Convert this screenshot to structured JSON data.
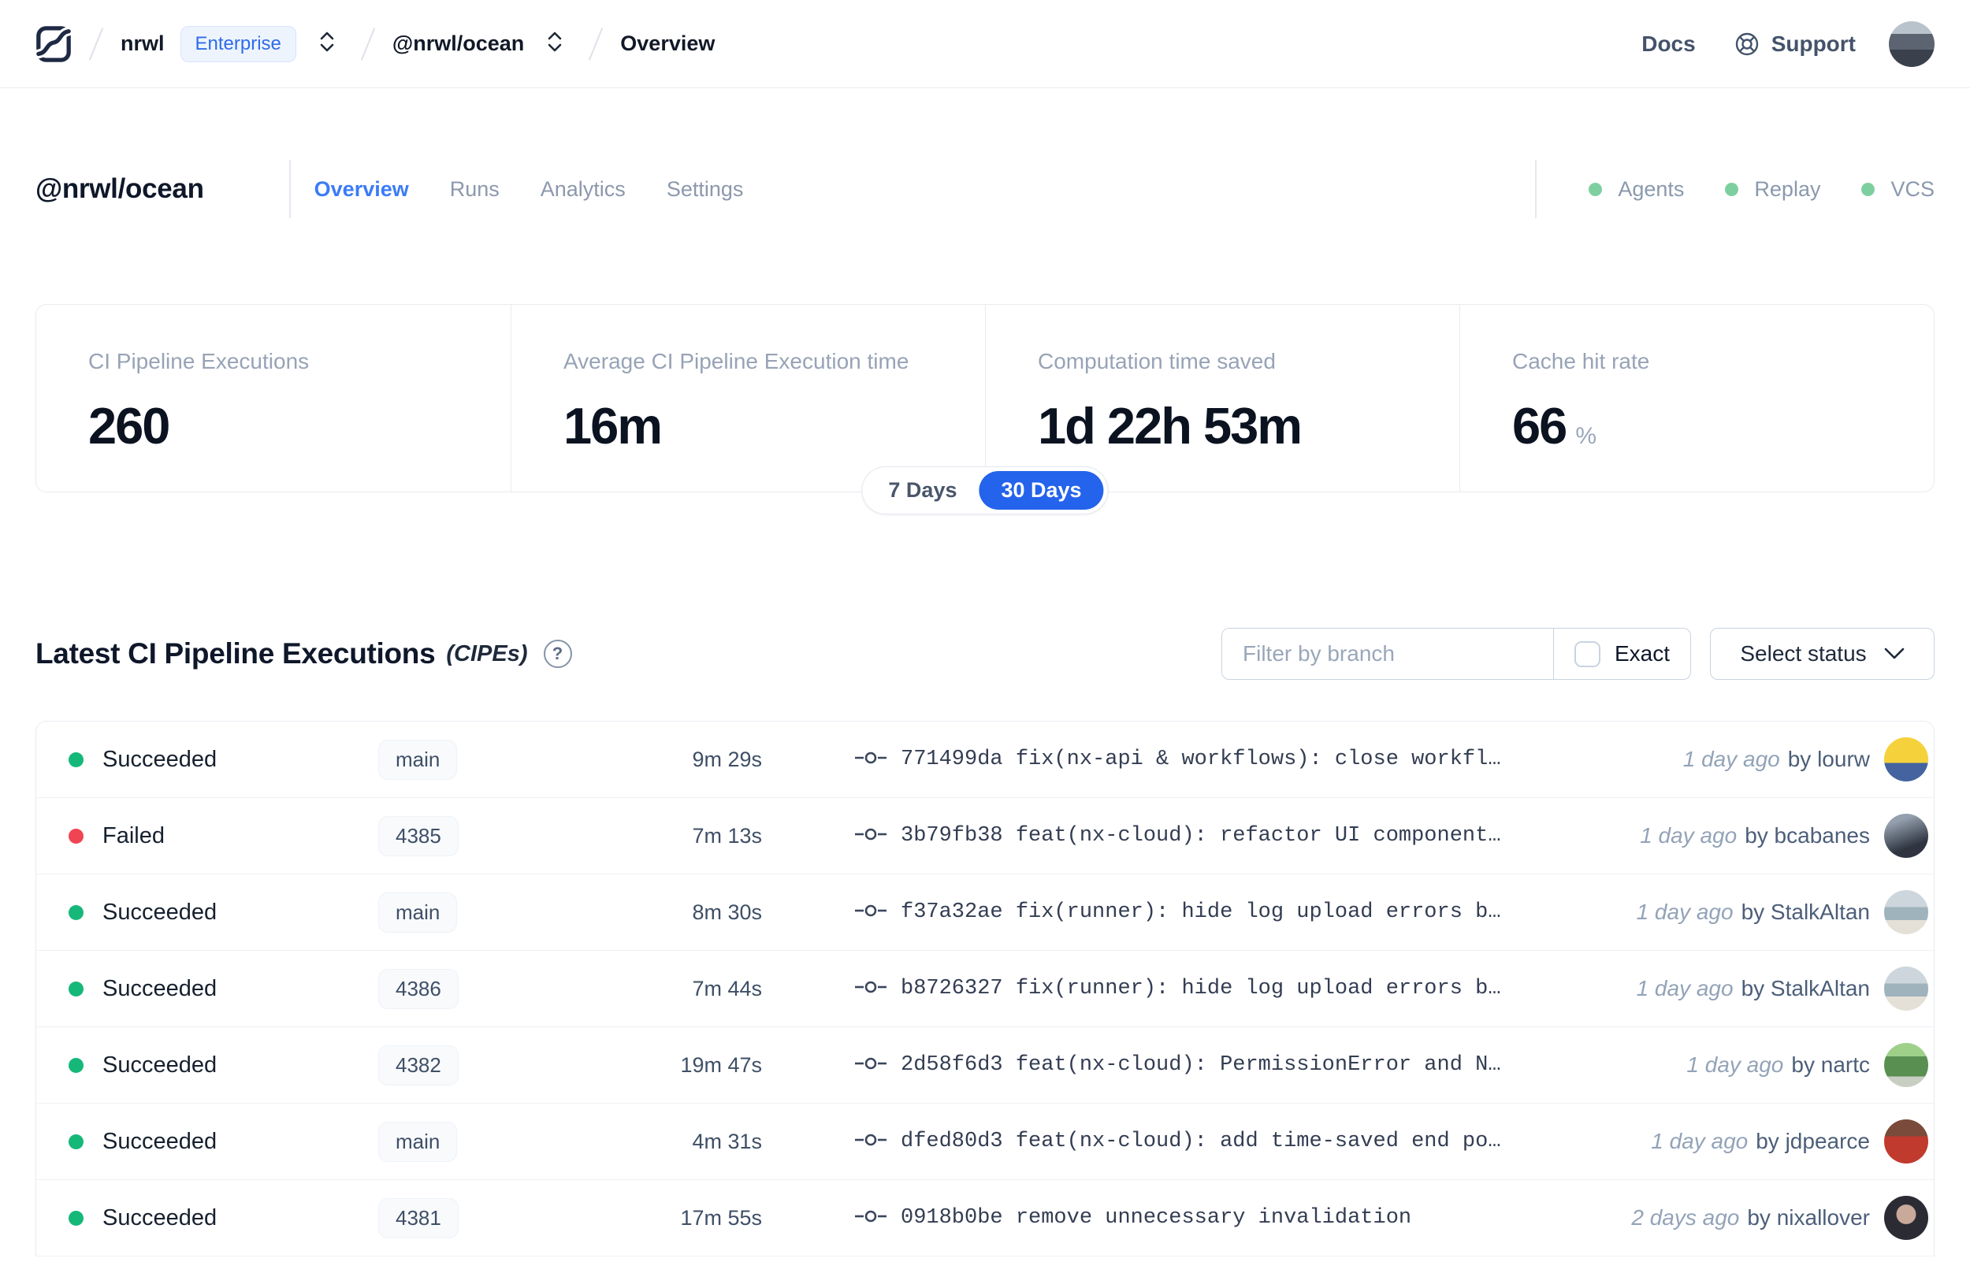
{
  "colors": {
    "accent_blue": "#2463eb",
    "active_tab_blue": "#3b7bf7",
    "success_green": "#16b87a",
    "failed_red": "#ef4453",
    "indicator_green": "#7ecfa0",
    "enterprise_badge_blue": "#2f6bea"
  },
  "icons": {
    "help_glyph": "?"
  },
  "header": {
    "breadcrumb": {
      "org": "nrwl",
      "org_badge": "Enterprise",
      "workspace": "@nrwl/ocean",
      "page": "Overview"
    },
    "nav": {
      "docs": "Docs",
      "support": "Support"
    },
    "avatar_css": "background:linear-gradient(180deg,#b9c3cc 28%,#5b6470 28% 62%,#3a414d 62%)"
  },
  "workspace": {
    "title": "@nrwl/ocean",
    "tabs": [
      {
        "label": "Overview",
        "active": true
      },
      {
        "label": "Runs",
        "active": false
      },
      {
        "label": "Analytics",
        "active": false
      },
      {
        "label": "Settings",
        "active": false
      }
    ],
    "indicators": [
      {
        "label": "Agents"
      },
      {
        "label": "Replay"
      },
      {
        "label": "VCS"
      }
    ]
  },
  "stats": {
    "cards": [
      {
        "label": "CI Pipeline Executions",
        "value": "260",
        "suffix": ""
      },
      {
        "label": "Average CI Pipeline Execution time",
        "value": "16m",
        "suffix": ""
      },
      {
        "label": "Computation time saved",
        "value": "1d 22h 53m",
        "suffix": ""
      },
      {
        "label": "Cache hit rate",
        "value": "66",
        "suffix": "%"
      }
    ],
    "range": {
      "options": [
        "7 Days",
        "30 Days"
      ],
      "selected": "30 Days"
    }
  },
  "cipes": {
    "title": "Latest CI Pipeline Executions",
    "title_suffix": "(CIPEs)",
    "filter": {
      "placeholder": "Filter by branch",
      "exact_label": "Exact"
    },
    "status_select": "Select status",
    "rows": [
      {
        "kind": "succeeded",
        "status": "Succeeded",
        "branch": "main",
        "duration": "9m 29s",
        "commit": "771499da fix(nx-api & workflows): close workfl…",
        "time": "1 day ago",
        "author": "by lourw",
        "avatar_css": "background:linear-gradient(180deg,#f5d23c 58%,#44639f 58%)"
      },
      {
        "kind": "failed",
        "status": "Failed",
        "branch": "4385",
        "duration": "7m 13s",
        "commit": "3b79fb38 feat(nx-cloud): refactor UI component…",
        "time": "1 day ago",
        "author": "by bcabanes",
        "avatar_css": "background:linear-gradient(160deg,#94a0ae 20%,#2e3440 72%)"
      },
      {
        "kind": "succeeded",
        "status": "Succeeded",
        "branch": "main",
        "duration": "8m 30s",
        "commit": "f37a32ae fix(runner): hide log upload errors b…",
        "time": "1 day ago",
        "author": "by StalkAltan",
        "avatar_css": "background:linear-gradient(180deg,#ccd6dc 38%,#9fb3bd 38% 68%,#e5e0d7 68%)"
      },
      {
        "kind": "succeeded",
        "status": "Succeeded",
        "branch": "4386",
        "duration": "7m 44s",
        "commit": "b8726327 fix(runner): hide log upload errors b…",
        "time": "1 day ago",
        "author": "by StalkAltan",
        "avatar_css": "background:linear-gradient(180deg,#ccd6dc 38%,#9fb3bd 38% 68%,#e5e0d7 68%)"
      },
      {
        "kind": "succeeded",
        "status": "Succeeded",
        "branch": "4382",
        "duration": "19m 47s",
        "commit": "2d58f6d3 feat(nx-cloud): PermissionError and N…",
        "time": "1 day ago",
        "author": "by nartc",
        "avatar_css": "background:linear-gradient(180deg,#9fd08a 30%,#5a8f52 30% 76%,#c9cec3 76%)"
      },
      {
        "kind": "succeeded",
        "status": "Succeeded",
        "branch": "main",
        "duration": "4m 31s",
        "commit": "dfed80d3 feat(nx-cloud): add time-saved end po…",
        "time": "1 day ago",
        "author": "by jdpearce",
        "avatar_css": "background:linear-gradient(180deg,#7a4a3a 38%,#c03a2e 38%)"
      },
      {
        "kind": "succeeded",
        "status": "Succeeded",
        "branch": "4381",
        "duration": "17m 55s",
        "commit": "0918b0be remove unnecessary invalidation",
        "time": "2 days ago",
        "author": "by nixallover",
        "avatar_css": "background:radial-gradient(circle at 50% 42%,#c9a99a 0 28%,#2b2b33 30%)"
      }
    ]
  }
}
